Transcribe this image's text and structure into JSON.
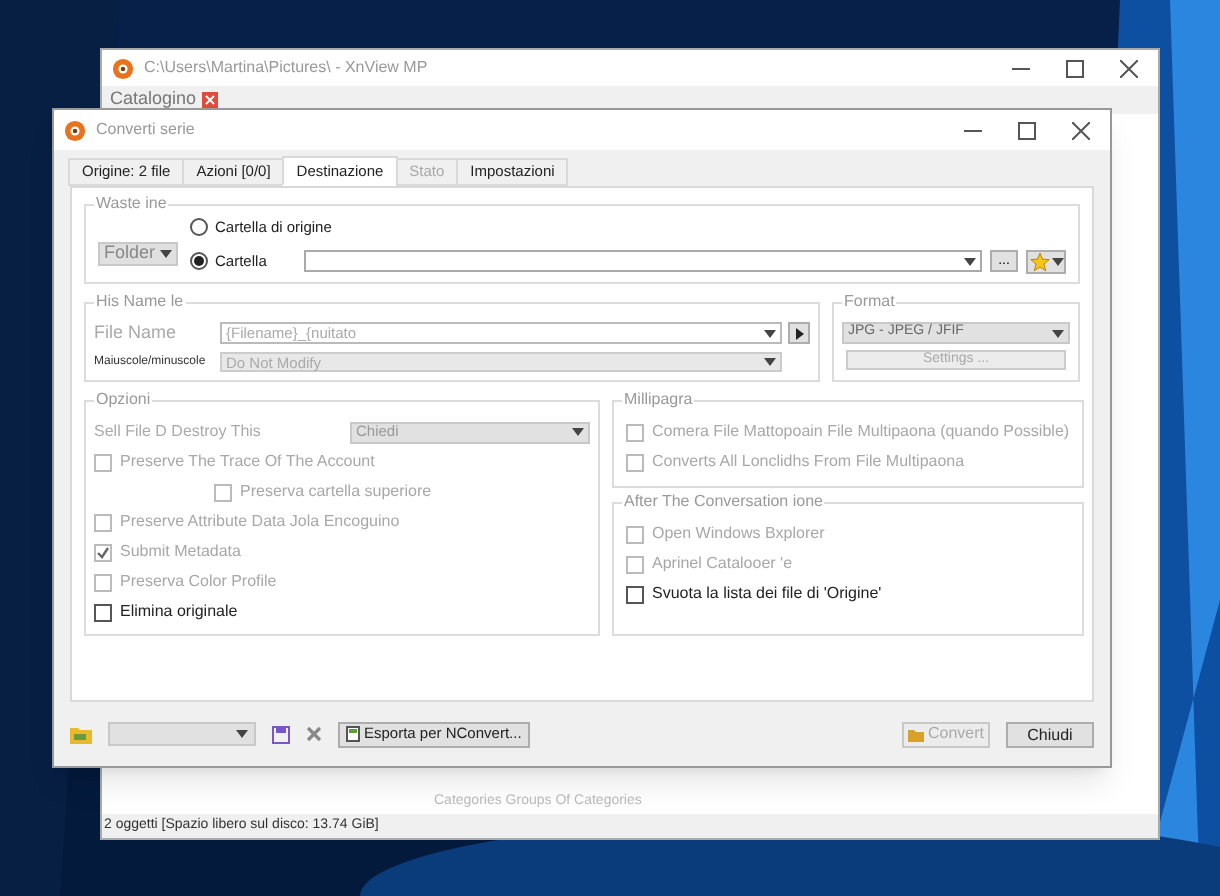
{
  "back_window": {
    "title": "C:\\Users\\Martina\\Pictures\\ - XnView MP",
    "tab": "Catalogino",
    "categories": "Categories Groups Of Categories",
    "status_bar": "2 oggetti [Spazio libero sul disco: 13.74 GiB]"
  },
  "dialog": {
    "title": "Converti serie",
    "tabs": [
      {
        "label": "Origine: 2 file",
        "selected": false,
        "disabled": false
      },
      {
        "label": "Azioni [0/0]",
        "selected": false,
        "disabled": false
      },
      {
        "label": "Destinazione",
        "selected": true,
        "disabled": false
      },
      {
        "label": "Stato",
        "selected": false,
        "disabled": true
      },
      {
        "label": "Impostazioni",
        "selected": false,
        "disabled": false
      }
    ],
    "destination": {
      "legend": "Waste ine",
      "folder_button": "Folder",
      "radios": [
        {
          "label": "Cartella di origine",
          "selected": false
        },
        {
          "label": "Cartella",
          "selected": true
        }
      ],
      "browse_button": "..."
    },
    "file_name": {
      "legend": "His Name le",
      "name_label": "File Name",
      "name_value": "{Filename}_{nuitato",
      "case_label": "Maiuscole/minuscole",
      "case_value": "Do Not Modify"
    },
    "format": {
      "legend": "Format",
      "value": "JPG - JPEG / JFIF",
      "settings_button": "Settings ..."
    },
    "options": {
      "legend": "Opzioni",
      "exists_label": "Sell File D Destroy This",
      "exists_value": "Chiedi",
      "checks": [
        {
          "label": "Preserve The Trace Of The Account",
          "checked": false,
          "disabled": true,
          "children": [
            {
              "label": "Preserva cartella superiore",
              "checked": false,
              "disabled": true
            }
          ]
        },
        {
          "label": "Preserve Attribute Data Jola Encoguino",
          "checked": false,
          "disabled": true
        },
        {
          "label": "Submit Metadata",
          "checked": true,
          "disabled": true
        },
        {
          "label": "Preserva Color Profile",
          "checked": false,
          "disabled": true
        },
        {
          "label": "Elimina originale",
          "checked": false,
          "disabled": false
        }
      ]
    },
    "multipage": {
      "legend": "Millipagra",
      "checks": [
        {
          "label": "Comera File Mattopoain File Multipaona (quando Possible)",
          "checked": false,
          "disabled": true
        },
        {
          "label": "Converts All Lonclidhs From File Multipaona",
          "checked": false,
          "disabled": true
        }
      ]
    },
    "after": {
      "legend": "After The Conversation ione",
      "checks": [
        {
          "label": "Open Windows Bxplorer",
          "checked": false,
          "disabled": true
        },
        {
          "label": "Aprinel Catalooer 'e",
          "checked": false,
          "disabled": true
        },
        {
          "label": "Svuota la lista dei file di 'Origine'",
          "checked": false,
          "disabled": false
        }
      ]
    },
    "bottom": {
      "export_button": "Esporta per NConvert...",
      "convert_button": "Convert",
      "convert_disabled": true,
      "close_button": "Chiudi"
    }
  }
}
